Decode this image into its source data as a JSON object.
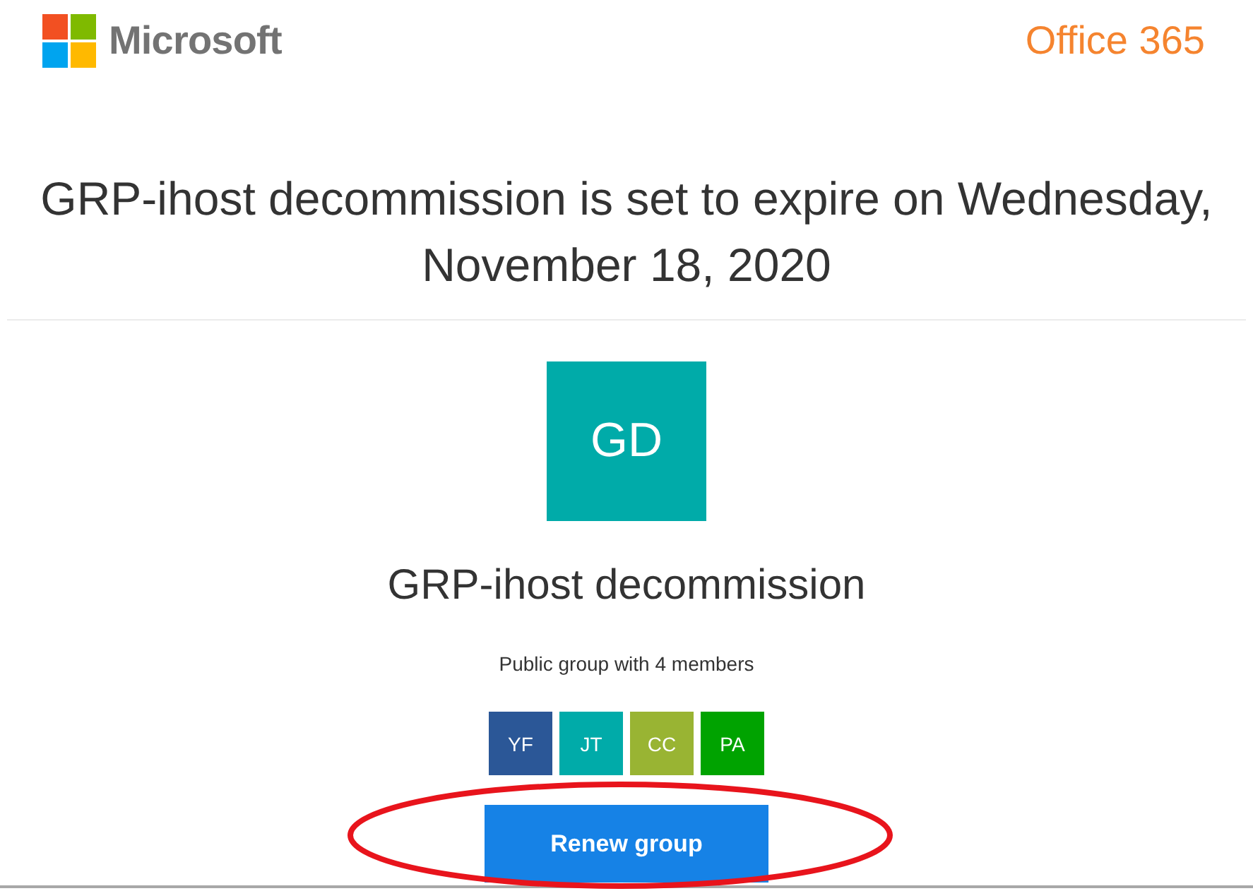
{
  "header": {
    "brand": "Microsoft",
    "product": "Office 365"
  },
  "headline": "GRP-ihost decommission is set to expire on Wednesday, November 18, 2020",
  "group": {
    "initials": "GD",
    "name": "GRP-ihost decommission",
    "description": "Public group with 4 members",
    "members": [
      {
        "initials": "YF",
        "color": "#2b5797"
      },
      {
        "initials": "JT",
        "color": "#00aba9"
      },
      {
        "initials": "CC",
        "color": "#99b433"
      },
      {
        "initials": "PA",
        "color": "#00a300"
      }
    ]
  },
  "action": {
    "label": "Renew group",
    "highlighted": true
  }
}
